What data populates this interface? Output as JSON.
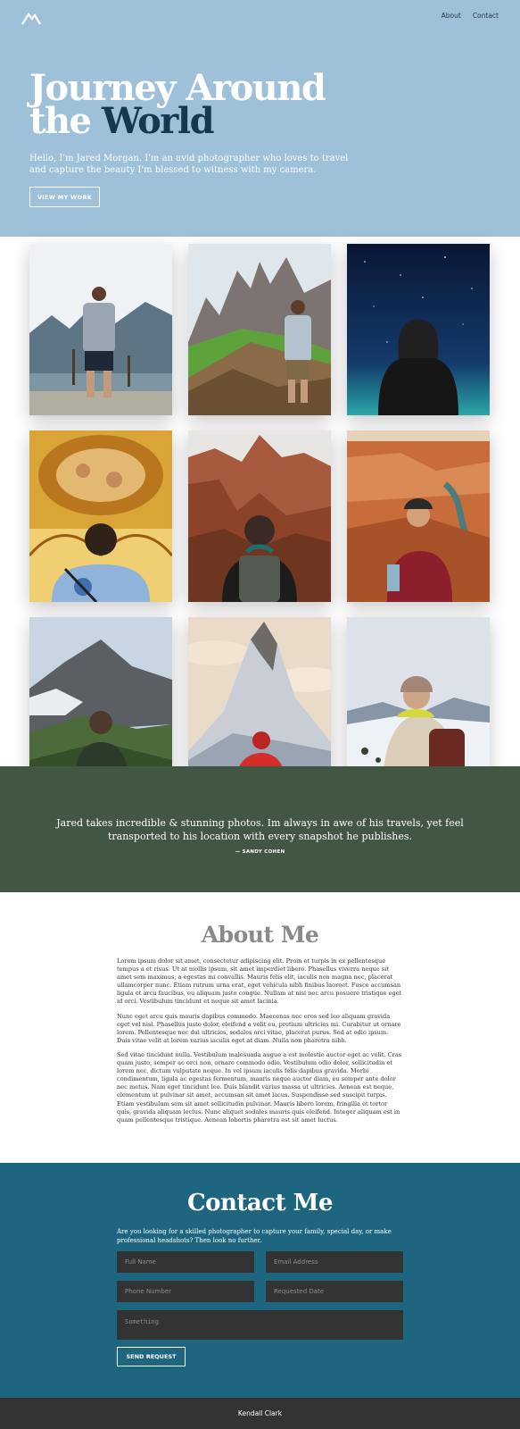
{
  "nav": {
    "items": [
      "About",
      "Contact"
    ]
  },
  "hero": {
    "title_line1": "Journey Around",
    "title_the": "the",
    "title_accent": "World",
    "intro": "Hello, I'm Jared Morgan. I'm an avid photographer who loves to travel and capture the beauty I'm blessed to witness with my camera.",
    "button": "VIEW MY WORK"
  },
  "gallery": {
    "photos": [
      "lake-mountains-photo",
      "green-ridge-peaks-photo",
      "starry-night-photo",
      "ornate-ceiling-photo",
      "canyon-cliffs-photo",
      "river-canyon-photo",
      "alpine-valley-photo",
      "matterhorn-photo",
      "snowy-landscape-photo"
    ]
  },
  "testimonial": {
    "quote": "Jared takes incredible & stunning photos. Im always in awe of his travels, yet feel transported to his location with every snapshot he publishes.",
    "author": "— SANDY COHEN"
  },
  "about": {
    "title": "About Me",
    "paragraphs": [
      "Lorem ipsum dolor sit amet, consectetur adipiscing elit. Proin et turpis in ex pellentesque tempus a et risus. Ut at mollis ipsum, sit amet imperdiet libero. Phasellus viverra neque sit amet sem maximus, a egestas mi convallis. Mauris felis elit, iaculis non magna nec, placerat ullamcorper nunc. Etiam rutrum urna erat, eget vehicula nibh finibus laoreet. Fusce accumsan ligula et arcu faucibus, eu aliquam justo congue. Nullam at nisi nec arcu posuere tristique eget id orci. Vestibulum tincidunt et neque sit amet lacinia.",
      "Nunc eget arcu quis mauris dapibus commodo. Maecenas nec eros sed leo aliquam gravida eget vel nisl. Phasellus justo dolor, eleifend a velit eu, pretium ultricies mi. Curabitur ut ornare lorem. Pellentesque nec dui ultricies, sodales orci vitae, placerat purus. Sed at odio ipsum. Duis vitae velit at lorem varius iaculis eget at diam. Nulla non pharetra nibh.",
      "Sed vitae tincidunt nulla. Vestibulum malesuada augue a est molestie auctor eget ac velit. Cras quam justo, semper ac orci non, ornare commodo odio. Vestibulum odio dolor, sollicitudin et lorem nec, dictum vulputate neque. In vel ipsum iaculis felis dapibus gravida. Morbi condimentum, ligula ac egestas fermentum, mauris neque auctor diam, eu semper ante dolor nec metus. Nam eget tincidunt leo. Duis blandit varius massa ut ultricies. Aenean est neque, elementum ut pulvinar sit amet, accumsan sit amet lacus. Suspendisse sed suscipit turpis. Etiam vestibulum sem sit amet sollicitudin pulvinar. Mauris libero lorem, fringilla et tortor quis, gravida aliquam lectus. Nunc aliquet sodales mauris quis eleifend. Integer aliquam est in quam pellentesque tristique. Aenean lobortis pharetra est sit amet luctus."
    ]
  },
  "contact": {
    "title": "Contact Me",
    "intro": "Are you looking for a skilled photographer to capture your family, special day, or make professional headshots? Then look no further.",
    "placeholders": {
      "full_name": "Full Name",
      "email": "Email Address",
      "phone": "Phone Number",
      "date": "Requested Date",
      "message": "Something"
    },
    "button": "SEND REQUEST"
  },
  "footer": {
    "text": "Kendall Clark"
  },
  "colors": {
    "hero_bg": "#9ec0d8",
    "accent_dark": "#14394d",
    "testimonial_bg": "#425743",
    "contact_bg": "#1e6680",
    "footer_bg": "#333333",
    "field_bg": "#333333"
  }
}
